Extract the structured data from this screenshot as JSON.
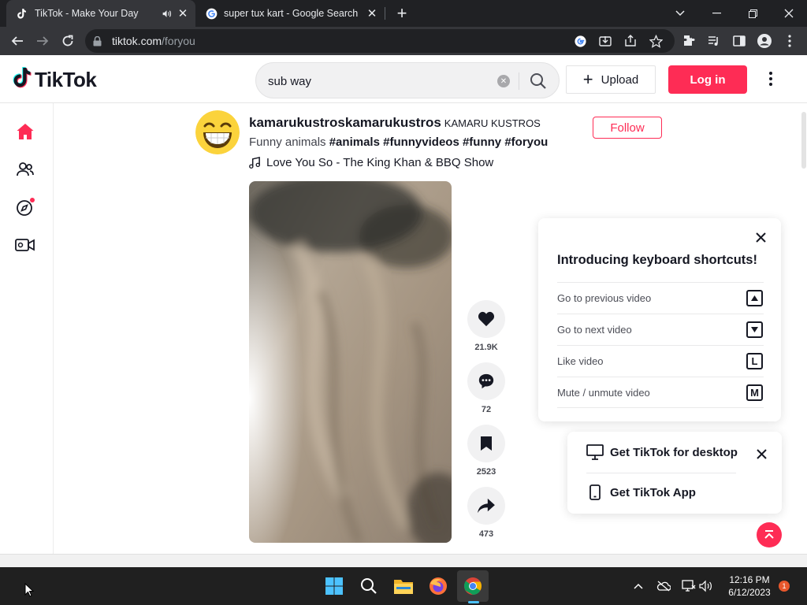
{
  "browser": {
    "tabs": [
      {
        "title": "TikTok - Make Your Day",
        "favicon": "tiktok-icon",
        "active": true,
        "audio": true
      },
      {
        "title": "super tux kart - Google Search",
        "favicon": "google-icon",
        "active": false
      }
    ],
    "url_host": "tiktok.com",
    "url_path": "/foryou"
  },
  "tiktok": {
    "logo_text": "TikTok",
    "search": {
      "value": "sub way"
    },
    "upload_label": "Upload",
    "login_label": "Log in",
    "brand_color": "#fe2c55"
  },
  "post": {
    "author_id": "kamarukustroskamarukustros",
    "author_name": "KAMARU KUSTROS",
    "follow_label": "Follow",
    "caption": "Funny animals",
    "hashtags": [
      "#animals",
      "#funnyvideos",
      "#funny",
      "#foryou"
    ],
    "music": "Love You So - The King Khan & BBQ Show",
    "actions": [
      {
        "name": "like",
        "icon": "heart-icon",
        "count": "21.9K"
      },
      {
        "name": "comment",
        "icon": "comment-icon",
        "count": "72"
      },
      {
        "name": "save",
        "icon": "bookmark-icon",
        "count": "2523"
      },
      {
        "name": "share",
        "icon": "share-icon",
        "count": "473"
      }
    ]
  },
  "shortcuts": {
    "title": "Introducing keyboard shortcuts!",
    "rows": [
      {
        "label": "Go to previous video",
        "key": "▲"
      },
      {
        "label": "Go to next video",
        "key": "▼"
      },
      {
        "label": "Like video",
        "key": "L"
      },
      {
        "label": "Mute / unmute video",
        "key": "M"
      }
    ]
  },
  "get_app": {
    "desktop_label": "Get TikTok for desktop",
    "app_label": "Get TikTok App"
  },
  "taskbar": {
    "time": "12:16 PM",
    "date": "6/12/2023",
    "notifications": "1"
  }
}
